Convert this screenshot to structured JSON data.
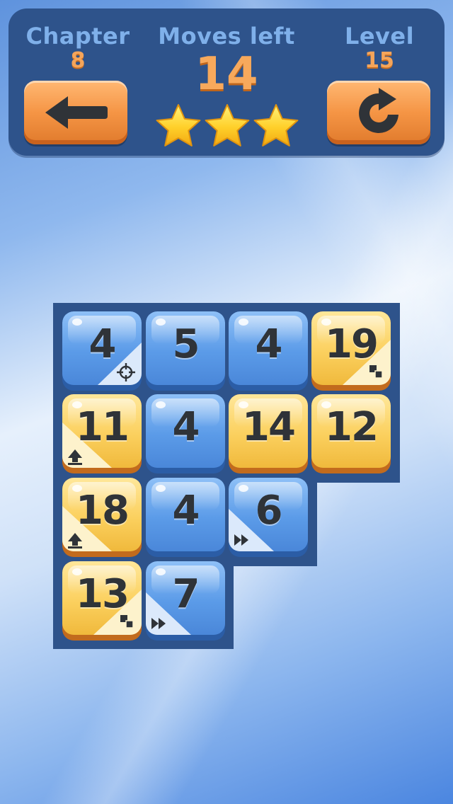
{
  "header": {
    "chapter_label": "Chapter",
    "chapter_value": "8",
    "moves_label": "Moves left",
    "moves_value": "14",
    "level_label": "Level",
    "level_value": "15",
    "stars_earned": 3,
    "stars_total": 3
  },
  "buttons": {
    "back_icon": "arrow-left-icon",
    "restart_icon": "restart-icon"
  },
  "board": {
    "tiles": [
      {
        "value": "4",
        "color": "blue",
        "badge": "target"
      },
      {
        "value": "5",
        "color": "blue",
        "badge": null
      },
      {
        "value": "4",
        "color": "blue",
        "badge": null
      },
      {
        "value": "19",
        "color": "yellow",
        "badge": "double"
      },
      {
        "value": "11",
        "color": "yellow",
        "badge": "up"
      },
      {
        "value": "4",
        "color": "blue",
        "badge": null
      },
      {
        "value": "14",
        "color": "yellow",
        "badge": null
      },
      {
        "value": "12",
        "color": "yellow",
        "badge": null
      },
      {
        "value": "18",
        "color": "yellow",
        "badge": "up"
      },
      {
        "value": "4",
        "color": "blue",
        "badge": null
      },
      {
        "value": "6",
        "color": "blue",
        "badge": "fast-forward"
      },
      {
        "value": "13",
        "color": "yellow",
        "badge": "double"
      },
      {
        "value": "7",
        "color": "blue",
        "badge": "fast-forward"
      }
    ]
  },
  "colors": {
    "header_bg": "#2e538b",
    "label": "#7fb0ea",
    "value_orange": "#f5a55a",
    "board_bg": "#2e538b",
    "tile_blue": "#5b9be8",
    "tile_yellow": "#fbd05e",
    "star": "#ffd02a"
  }
}
